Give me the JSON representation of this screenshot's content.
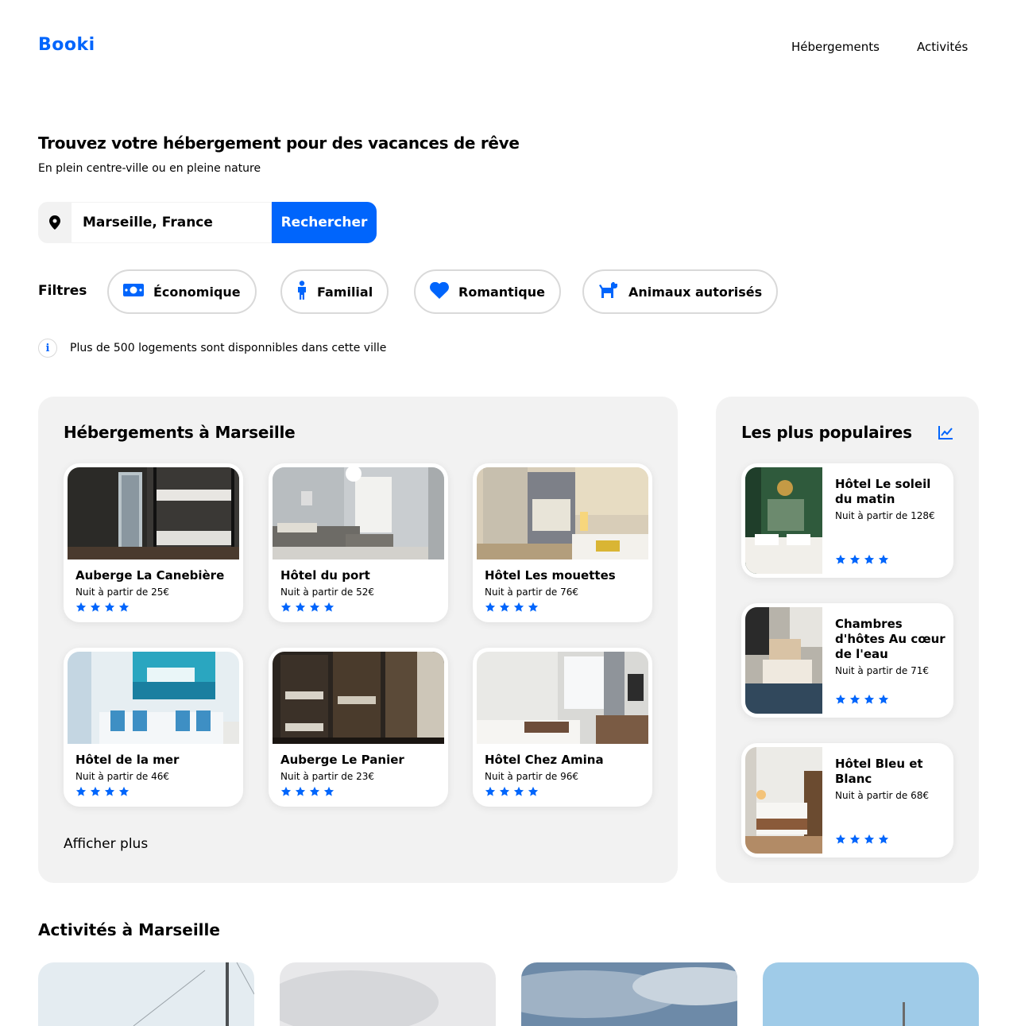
{
  "brand": "Booki",
  "nav": {
    "item1": "Hébergements",
    "item2": "Activités"
  },
  "hero": {
    "title": "Trouvez votre hébergement pour des vacances de rêve",
    "subtitle": "En plein centre-ville ou en pleine nature"
  },
  "search": {
    "value": "Marseille, France",
    "button": "Rechercher",
    "icon": "location-pin-icon"
  },
  "filters": {
    "label": "Filtres",
    "items": [
      {
        "label": "Économique",
        "icon": "money-icon"
      },
      {
        "label": "Familial",
        "icon": "child-icon"
      },
      {
        "label": "Romantique",
        "icon": "heart-icon"
      },
      {
        "label": "Animaux autorisés",
        "icon": "dog-icon"
      }
    ]
  },
  "info": {
    "text": "Plus de 500 logements sont disponnibles dans cette ville",
    "icon": "info-icon"
  },
  "lodgings": {
    "title": "Hébergements à Marseille",
    "show_more": "Afficher plus",
    "items": [
      {
        "name": "Auberge La Canebière",
        "price": "Nuit à partir de 25€",
        "rating": 4
      },
      {
        "name": "Hôtel du port",
        "price": "Nuit à partir de 52€",
        "rating": 4
      },
      {
        "name": "Hôtel Les mouettes",
        "price": "Nuit à partir de 76€",
        "rating": 4
      },
      {
        "name": "Hôtel de la mer",
        "price": "Nuit à partir de 46€",
        "rating": 4
      },
      {
        "name": "Auberge Le Panier",
        "price": "Nuit à partir de 23€",
        "rating": 4
      },
      {
        "name": "Hôtel Chez Amina",
        "price": "Nuit à partir de 96€",
        "rating": 4
      }
    ]
  },
  "popular": {
    "title": "Les plus populaires",
    "icon": "trend-chart-icon",
    "items": [
      {
        "name": "Hôtel Le soleil du matin",
        "price": "Nuit à partir de 128€",
        "rating": 4
      },
      {
        "name": "Chambres d'hôtes Au cœur de l'eau",
        "price": "Nuit à partir de 71€",
        "rating": 4
      },
      {
        "name": "Hôtel Bleu et Blanc",
        "price": "Nuit à partir de 68€",
        "rating": 4
      }
    ]
  },
  "activities": {
    "title": "Activités à Marseille"
  },
  "colors": {
    "accent": "#0065fc",
    "panel": "#f2f2f2",
    "border": "#d9d9d9"
  }
}
